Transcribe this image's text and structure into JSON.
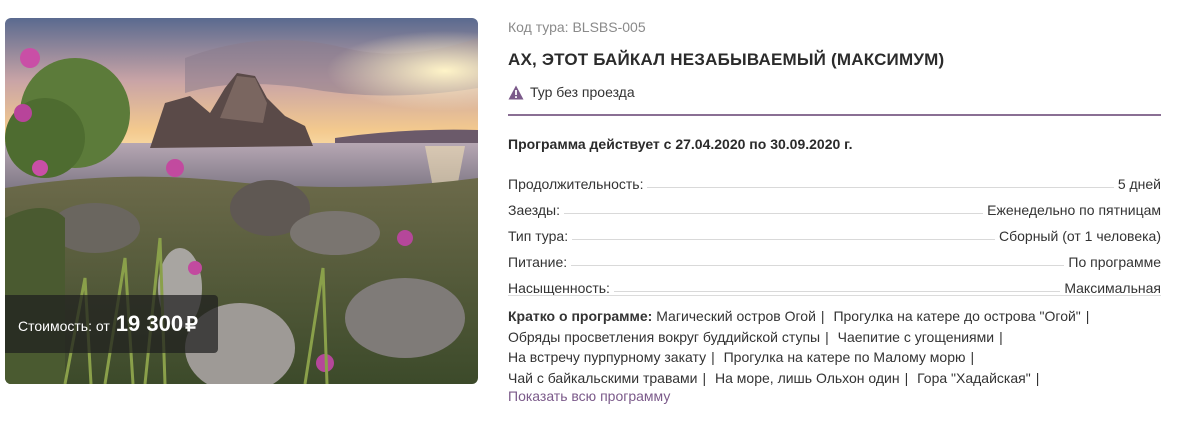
{
  "tour": {
    "code": "Код тура: BLSBS-005",
    "title": "АХ, ЭТОТ БАЙКАЛ НЕЗАБЫВАЕМЫЙ (МАКСИМУМ)",
    "notice": "Тур без проезда",
    "notice_icon": "warning-triangle-icon",
    "accent_color": "#8a6f94",
    "program_dates": "Программа действует с 27.04.2020 по 30.09.2020 г."
  },
  "price": {
    "label": "Стоимость: от",
    "value": "19 300",
    "currency": "₽"
  },
  "params": [
    {
      "label": "Продолжительность:",
      "value": "5 дней"
    },
    {
      "label": "Заезды:",
      "value": "Еженедельно по пятницам"
    },
    {
      "label": "Тип тура:",
      "value": "Сборный (от 1 человека)"
    },
    {
      "label": "Питание:",
      "value": "По программе"
    },
    {
      "label": "Насыщенность:",
      "value": "Максимальная"
    }
  ],
  "summary": {
    "title": "Кратко о программе:",
    "items": [
      "Магический остров Огой",
      "Прогулка на катере до острова \"Огой\"",
      "Обряды просветления вокруг буддийской ступы",
      "Чаепитие с угощениями",
      "На встречу пурпурному закату",
      "Прогулка на катере по Малому морю",
      "Чай с байкальскими травами",
      "На море, лишь Ольхон один",
      "Гора \"Хадайская\""
    ],
    "separator": "|"
  },
  "show_all_label": "Показать всю программу"
}
